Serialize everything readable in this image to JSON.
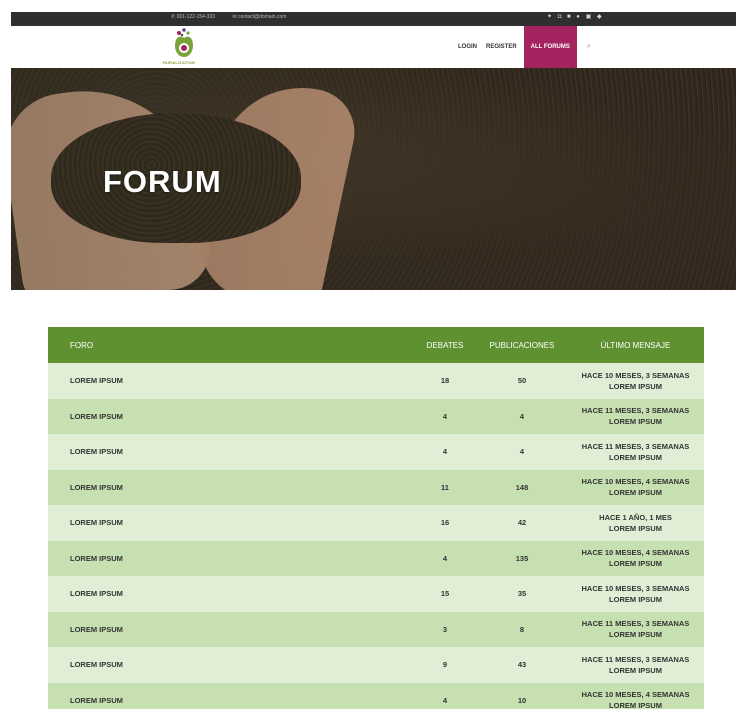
{
  "topbar": {
    "phone": "001-122-154-333",
    "email": "contact@domain.com",
    "social_icons": [
      "twitter-icon",
      "instagram-icon",
      "facebook-icon",
      "google-plus-icon",
      "linkedin-icon",
      "vimeo-icon"
    ]
  },
  "header": {
    "logo_text": "RURALIZATION",
    "nav": {
      "login": "LOGIN",
      "register": "REGISTER",
      "all_forums": "ALL FORUMS"
    },
    "search_glyph": "⌕"
  },
  "hero": {
    "title": "FORUM"
  },
  "forum_table": {
    "headers": {
      "forum": "FORO",
      "debates": "DEBATES",
      "posts": "PUBLICACIONES",
      "last": "ÚLTIMO MENSAJE"
    },
    "rows": [
      {
        "forum": "LOREM IPSUM",
        "debates": "18",
        "posts": "50",
        "last_time": "HACE 10 MESES, 3 SEMANAS",
        "last_author": "LOREM IPSUM"
      },
      {
        "forum": "LOREM IPSUM",
        "debates": "4",
        "posts": "4",
        "last_time": "HACE 11 MESES, 3 SEMANAS",
        "last_author": "LOREM IPSUM"
      },
      {
        "forum": "LOREM IPSUM",
        "debates": "4",
        "posts": "4",
        "last_time": "HACE 11 MESES, 3 SEMANAS",
        "last_author": "LOREM IPSUM"
      },
      {
        "forum": "LOREM IPSUM",
        "debates": "11",
        "posts": "148",
        "last_time": "HACE 10 MESES, 4 SEMANAS",
        "last_author": "LOREM IPSUM"
      },
      {
        "forum": "LOREM IPSUM",
        "debates": "16",
        "posts": "42",
        "last_time": "HACE 1 AÑO, 1 MES",
        "last_author": "LOREM IPSUM"
      },
      {
        "forum": "LOREM IPSUM",
        "debates": "4",
        "posts": "135",
        "last_time": "HACE 10 MESES, 4 SEMANAS",
        "last_author": "LOREM IPSUM"
      },
      {
        "forum": "LOREM IPSUM",
        "debates": "15",
        "posts": "35",
        "last_time": "HACE 10 MESES, 3 SEMANAS",
        "last_author": "LOREM IPSUM"
      },
      {
        "forum": "LOREM IPSUM",
        "debates": "3",
        "posts": "8",
        "last_time": "HACE 11 MESES, 3 SEMANAS",
        "last_author": "LOREM IPSUM"
      },
      {
        "forum": "LOREM IPSUM",
        "debates": "9",
        "posts": "43",
        "last_time": "HACE 11 MESES, 3 SEMANAS",
        "last_author": "LOREM IPSUM"
      },
      {
        "forum": "LOREM IPSUM",
        "debates": "4",
        "posts": "10",
        "last_time": "HACE 10 MESES, 4 SEMANAS",
        "last_author": "LOREM IPSUM"
      }
    ]
  },
  "colors": {
    "topbar": "#2f2f2f",
    "accent": "#a3245e",
    "table_header": "#5f9130",
    "row_light": "#dfeed4",
    "row_dark": "#c6e0b1"
  }
}
